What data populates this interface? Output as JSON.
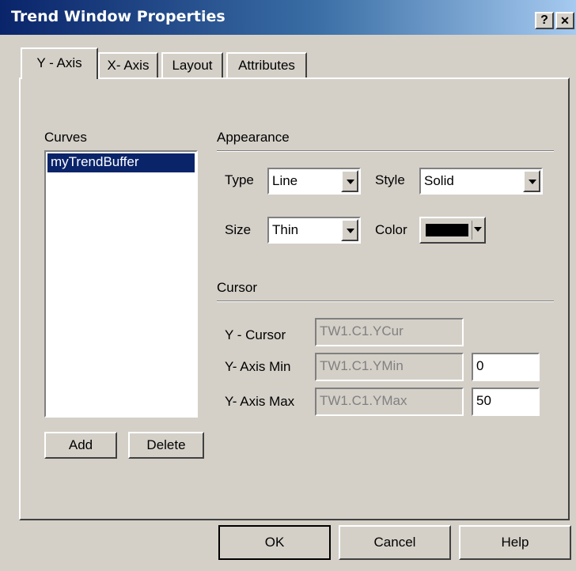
{
  "window": {
    "title": "Trend Window Properties",
    "help_button": "?",
    "close_button": "✕"
  },
  "tabs": [
    {
      "label": "Y - Axis",
      "active": true
    },
    {
      "label": "X- Axis",
      "active": false
    },
    {
      "label": "Layout",
      "active": false
    },
    {
      "label": "Attributes",
      "active": false
    }
  ],
  "curves": {
    "label": "Curves",
    "items": [
      "myTrendBuffer"
    ],
    "selected_index": 0,
    "add_label": "Add",
    "delete_label": "Delete"
  },
  "appearance": {
    "heading": "Appearance",
    "type_label": "Type",
    "type_value": "Line",
    "style_label": "Style",
    "style_value": "Solid",
    "size_label": "Size",
    "size_value": "Thin",
    "color_label": "Color",
    "color_value": "#000000"
  },
  "cursor": {
    "heading": "Cursor",
    "y_cursor_label": "Y - Cursor",
    "y_cursor_value": "TW1.C1.YCur",
    "y_min_label": "Y- Axis Min",
    "y_min_var": "TW1.C1.YMin",
    "y_min_value": "0",
    "y_max_label": "Y- Axis Max",
    "y_max_var": "TW1.C1.YMax",
    "y_max_value": "50"
  },
  "footer": {
    "ok_label": "OK",
    "cancel_label": "Cancel",
    "help_label": "Help"
  },
  "colors": {
    "face": "#d4d0c8",
    "title_active": "#0a246a",
    "selection": "#0a246a"
  }
}
